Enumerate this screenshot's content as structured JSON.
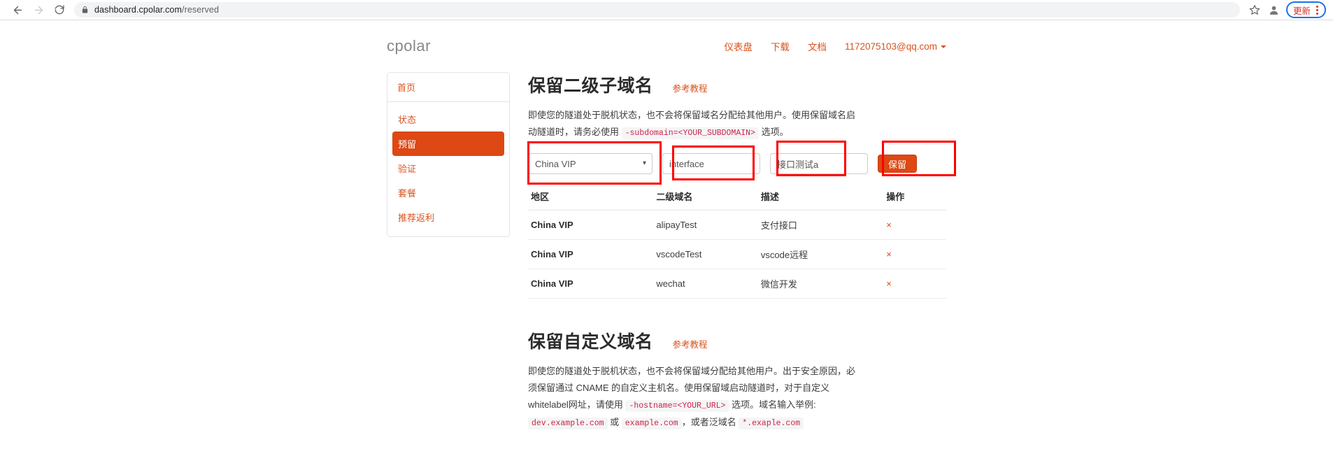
{
  "browser": {
    "back_icon": "arrow-left-icon",
    "forward_icon": "arrow-right-icon",
    "reload_icon": "reload-icon",
    "lock_icon": "lock-icon",
    "url_host": "dashboard.cpolar.com",
    "url_path": "/reserved",
    "bookmark_icon": "star-icon",
    "profile_icon": "profile-avatar-icon",
    "update_label": "更新",
    "menu_icon": "kebab-menu-icon"
  },
  "header": {
    "brand": "cpolar",
    "nav": [
      {
        "label": "仪表盘",
        "name": "nav-dashboard"
      },
      {
        "label": "下载",
        "name": "nav-download"
      },
      {
        "label": "文档",
        "name": "nav-docs"
      }
    ],
    "account": "1172075103@qq.com"
  },
  "sidebar": {
    "home": {
      "label": "首页"
    },
    "items": [
      {
        "label": "状态",
        "active": false
      },
      {
        "label": "预留",
        "active": true
      },
      {
        "label": "验证",
        "active": false
      },
      {
        "label": "套餐",
        "active": false
      },
      {
        "label": "推荐返利",
        "active": false
      }
    ]
  },
  "section1": {
    "title": "保留二级子域名",
    "link": "参考教程",
    "desc_part1": "即使您的隧道处于脱机状态，也不会将保留域名分配给其他用户。使用保留域名启动隧道时，请务必使用 ",
    "desc_code": "-subdomain=<YOUR_SUBDOMAIN>",
    "desc_part2": " 选项。",
    "form": {
      "region_value": "China VIP",
      "region_options": [
        "China VIP"
      ],
      "subdomain_value": "interface",
      "subdomain_placeholder": "",
      "description_value": "接口测试a",
      "description_placeholder": "",
      "submit_label": "保留",
      "caret_icon": "chevron-down-icon"
    },
    "table": {
      "headers": [
        "地区",
        "二级域名",
        "描述",
        "操作"
      ],
      "rows": [
        {
          "region": "China VIP",
          "subdomain": "alipayTest",
          "description": "支付接口",
          "action": "×"
        },
        {
          "region": "China VIP",
          "subdomain": "vscodeTest",
          "description": "vscode远程",
          "action": "×"
        },
        {
          "region": "China VIP",
          "subdomain": "wechat",
          "description": "微信开发",
          "action": "×"
        }
      ]
    }
  },
  "section2": {
    "title": "保留自定义域名",
    "link": "参考教程",
    "desc_part1": "即使您的隧道处于脱机状态，也不会将保留域分配给其他用户。出于安全原因，必须保留通过 CNAME 的自定义主机名。使用保留域启动隧道时，对于自定义whitelabel网址，请使用 ",
    "desc_code1": "-hostname=<YOUR_URL>",
    "desc_part2": " 选项。域名输入举例: ",
    "desc_code2": "dev.example.com",
    "desc_part3": " 或 ",
    "desc_code3": "example.com",
    "desc_part4": "，或者泛域名 ",
    "desc_code4": "*.exaple.com"
  },
  "colors": {
    "brand_orange": "#dd4814",
    "link_orange": "#d9531e",
    "annotation_red": "#ff0000",
    "chrome_blue": "#1a73e8",
    "update_red": "#d93025"
  }
}
